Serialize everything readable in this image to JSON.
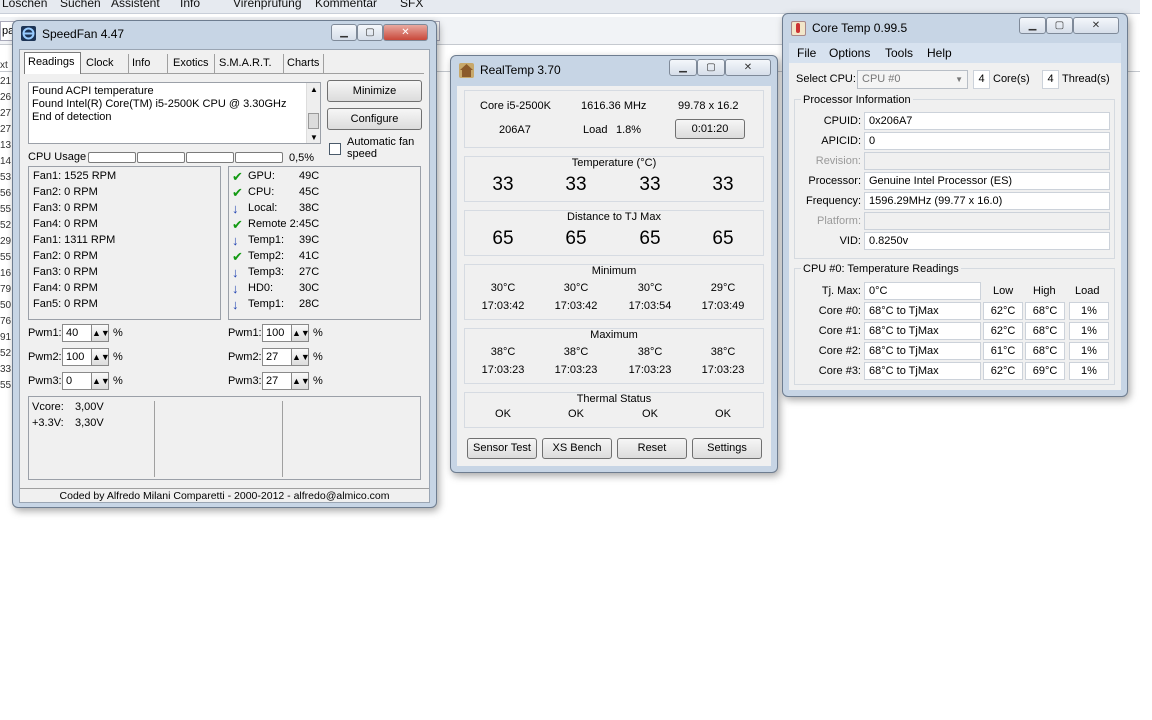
{
  "background": {
    "menu": [
      "Löschen",
      "Suchen",
      "Assistent",
      "Info",
      "Virenprüfung",
      "Kommentar",
      "SFX"
    ],
    "sidebar_frag": [
      "xt",
      "21",
      "26",
      "27",
      "27",
      "13",
      "14",
      "53",
      "56",
      "55",
      "52",
      "29",
      "55",
      "16",
      "79",
      "50",
      "76",
      "91",
      "52",
      "33",
      "55"
    ],
    "field_frag": "pa"
  },
  "speedfan": {
    "title": "SpeedFan 4.47",
    "tabs": [
      "Readings",
      "Clock",
      "Info",
      "Exotics",
      "S.M.A.R.T.",
      "Charts"
    ],
    "log": [
      "Found ACPI temperature",
      "Found Intel(R) Core(TM) i5-2500K CPU @ 3.30GHz",
      "End of detection"
    ],
    "minimize_label": "Minimize",
    "configure_label": "Configure",
    "auto_fan_label": "Automatic fan speed",
    "cpu_usage_label": "CPU Usage",
    "cpu_usage_value": "0,5%",
    "fans": [
      "Fan1: 1525 RPM",
      "Fan2: 0 RPM",
      "Fan3: 0 RPM",
      "Fan4: 0 RPM",
      "Fan1: 1311 RPM",
      "Fan2: 0 RPM",
      "Fan3: 0 RPM",
      "Fan4: 0 RPM",
      "Fan5: 0 RPM"
    ],
    "temps": [
      {
        "name": "GPU:",
        "value": "49C",
        "icon": "ok"
      },
      {
        "name": "CPU:",
        "value": "45C",
        "icon": "ok"
      },
      {
        "name": "Local:",
        "value": "38C",
        "icon": "down"
      },
      {
        "name": "Remote 2:",
        "value": "45C",
        "icon": "ok"
      },
      {
        "name": "Temp1:",
        "value": "39C",
        "icon": "down"
      },
      {
        "name": "Temp2:",
        "value": "41C",
        "icon": "ok"
      },
      {
        "name": "Temp3:",
        "value": "27C",
        "icon": "down"
      },
      {
        "name": "HD0:",
        "value": "30C",
        "icon": "down"
      },
      {
        "name": "Temp1:",
        "value": "28C",
        "icon": "down"
      }
    ],
    "pwm_left": [
      {
        "label": "Pwm1:",
        "value": "40"
      },
      {
        "label": "Pwm2:",
        "value": "100"
      },
      {
        "label": "Pwm3:",
        "value": "0"
      }
    ],
    "pwm_right": [
      {
        "label": "Pwm1:",
        "value": "100"
      },
      {
        "label": "Pwm2:",
        "value": "27"
      },
      {
        "label": "Pwm3:",
        "value": "27"
      }
    ],
    "pct": "%",
    "volts": [
      {
        "label": "Vcore:",
        "value": "3,00V"
      },
      {
        "label": "+3.3V:",
        "value": "3,30V"
      }
    ],
    "footer": "Coded by Alfredo Milani Comparetti - 2000-2012 - alfredo@almico.com"
  },
  "realtemp": {
    "title": "RealTemp 3.70",
    "cpu": "Core i5-2500K",
    "freq": "1616.36 MHz",
    "mult": "99.78 x 16.2",
    "cpuid": "206A7",
    "load_label": "Load",
    "load_value": "1.8%",
    "timer": "0:01:20",
    "temp_label": "Temperature (°C)",
    "temps": [
      "33",
      "33",
      "33",
      "33"
    ],
    "dist_label": "Distance to TJ Max",
    "dists": [
      "65",
      "65",
      "65",
      "65"
    ],
    "min_label": "Minimum",
    "min_temps": [
      "30°C",
      "30°C",
      "30°C",
      "29°C"
    ],
    "min_times": [
      "17:03:42",
      "17:03:42",
      "17:03:54",
      "17:03:49"
    ],
    "max_label": "Maximum",
    "max_temps": [
      "38°C",
      "38°C",
      "38°C",
      "38°C"
    ],
    "max_times": [
      "17:03:23",
      "17:03:23",
      "17:03:23",
      "17:03:23"
    ],
    "thermal_label": "Thermal Status",
    "thermal": [
      "OK",
      "OK",
      "OK",
      "OK"
    ],
    "buttons": [
      "Sensor Test",
      "XS Bench",
      "Reset",
      "Settings"
    ]
  },
  "coretemp": {
    "title": "Core Temp 0.99.5",
    "menu": [
      "File",
      "Options",
      "Tools",
      "Help"
    ],
    "select_label": "Select CPU:",
    "select_value": "CPU #0",
    "cores_count": "4",
    "cores_label": "Core(s)",
    "threads_count": "4",
    "threads_label": "Thread(s)",
    "proc_info_label": "Processor Information",
    "info": [
      {
        "label": "CPUID:",
        "value": "0x206A7",
        "disabled": false
      },
      {
        "label": "APICID:",
        "value": "0",
        "disabled": false
      },
      {
        "label": "Revision:",
        "value": "",
        "disabled": true
      },
      {
        "label": "Processor:",
        "value": "Genuine Intel Processor (ES)",
        "disabled": false
      },
      {
        "label": "Frequency:",
        "value": "1596.29MHz (99.77 x 16.0)",
        "disabled": false
      },
      {
        "label": "Platform:",
        "value": "",
        "disabled": true
      },
      {
        "label": "VID:",
        "value": "0.8250v",
        "disabled": false
      }
    ],
    "readings_label": "CPU #0: Temperature Readings",
    "tj_label": "Tj. Max:",
    "tj_value": "0°C",
    "col_low": "Low",
    "col_high": "High",
    "col_load": "Load",
    "cores": [
      {
        "label": "Core #0:",
        "value": "68°C to TjMax",
        "low": "62°C",
        "high": "68°C",
        "load": "1%"
      },
      {
        "label": "Core #1:",
        "value": "68°C to TjMax",
        "low": "62°C",
        "high": "68°C",
        "load": "1%"
      },
      {
        "label": "Core #2:",
        "value": "68°C to TjMax",
        "low": "61°C",
        "high": "68°C",
        "load": "1%"
      },
      {
        "label": "Core #3:",
        "value": "68°C to TjMax",
        "low": "62°C",
        "high": "69°C",
        "load": "1%"
      }
    ]
  }
}
